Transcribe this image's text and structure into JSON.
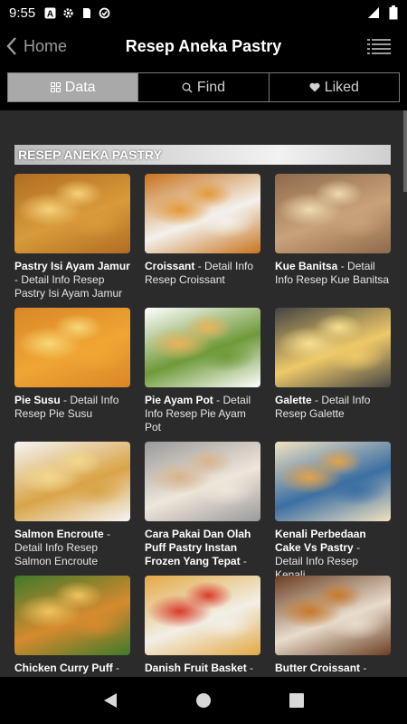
{
  "status": {
    "time": "9:55"
  },
  "appbar": {
    "back_label": "Home",
    "title": "Resep Aneka Pastry"
  },
  "tabs": [
    {
      "label": "Data",
      "icon": "grid-icon",
      "active": true
    },
    {
      "label": "Find",
      "icon": "search-icon",
      "active": false
    },
    {
      "label": "Liked",
      "icon": "heart-icon",
      "active": false
    }
  ],
  "section": {
    "title": "RESEP ANEKA PASTRY"
  },
  "recipes": [
    {
      "name": "Pastry Isi Ayam Jamur",
      "desc": " - Detail Info Resep Pastry Isi Ayam Jamur",
      "colors": [
        "#d99a3a",
        "#f6d27a",
        "#b06d22"
      ]
    },
    {
      "name": "Croissant",
      "desc": " - Detail Info Resep Croissant",
      "colors": [
        "#f3f1ec",
        "#e29a3b",
        "#c8741e"
      ]
    },
    {
      "name": "Kue Banitsa",
      "desc": " - Detail Info Resep Kue Banitsa",
      "colors": [
        "#c8a27a",
        "#f0d9b0",
        "#8e6a4a"
      ]
    },
    {
      "name": "Pie Susu",
      "desc": " - Detail Info Resep Pie Susu",
      "colors": [
        "#f0a533",
        "#f8d777",
        "#d98727"
      ]
    },
    {
      "name": "Pie Ayam Pot",
      "desc": " - Detail Info Resep Pie Ayam Pot",
      "colors": [
        "#6f9a3a",
        "#e8b45a",
        "#ffffff"
      ]
    },
    {
      "name": "Galette",
      "desc": " - Detail Info Resep Galette",
      "colors": [
        "#eec968",
        "#f7df8f",
        "#444444"
      ]
    },
    {
      "name": "Salmon Encroute",
      "desc": " - Detail Info Resep Salmon Encroute",
      "colors": [
        "#d9a447",
        "#f3d88e",
        "#f5f5f5"
      ]
    },
    {
      "name": "Cara Pakai Dan Olah Puff Pastry Instan Frozen Yang Tepat",
      "desc": " - ",
      "colors": [
        "#efe6da",
        "#d8b58a",
        "#9a9a9a"
      ]
    },
    {
      "name": "Kenali Perbedaan Cake Vs Pastry",
      "desc": " - Detail Info Resep Kenali",
      "colors": [
        "#3b6fa3",
        "#e2a24a",
        "#f2e2c0"
      ]
    },
    {
      "name": "Chicken Curry Puff",
      "desc": " - Detail Info Resep",
      "colors": [
        "#d78a2e",
        "#f1c35e",
        "#3f7a2a"
      ]
    },
    {
      "name": "Danish Fruit Basket",
      "desc": " - Detail Info Resep",
      "colors": [
        "#f2efe6",
        "#d83b2c",
        "#e3a945"
      ]
    },
    {
      "name": "Butter Croissant",
      "desc": " - Detail Info Resep Butter",
      "colors": [
        "#e8dccc",
        "#c77a2a",
        "#6b3f22"
      ]
    }
  ],
  "nav": {
    "back": "back-icon",
    "home": "home-icon",
    "recents": "recents-icon"
  }
}
